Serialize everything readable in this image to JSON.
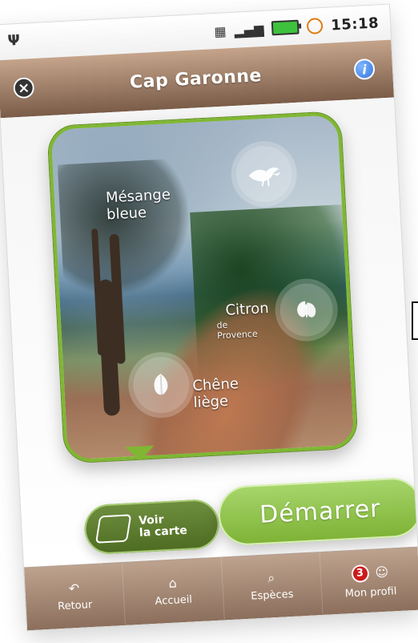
{
  "status_bar": {
    "time": "15:18",
    "icons": {
      "usb": "usb-icon",
      "signal": "signal-icon",
      "battery": "battery-icon",
      "alarm": "alarm-icon",
      "data": "data-icon"
    }
  },
  "header": {
    "title": "Cap Garonne",
    "icons": {
      "close": "close-icon",
      "info": "info-icon"
    }
  },
  "photo": {
    "pois": [
      {
        "label": "Mésange bleue",
        "icon": "bird-icon"
      },
      {
        "label": "Citron",
        "sublabel": "de Provence",
        "icon": "butterfly-icon"
      },
      {
        "label": "Chêne liège",
        "icon": "leaf-icon"
      }
    ]
  },
  "actions": {
    "map_button": {
      "line1": "Voir",
      "line2": "la carte",
      "icon": "map-icon"
    },
    "start_button": {
      "label": "Démarrer"
    }
  },
  "tabbar": {
    "tabs": [
      {
        "label": "Retour",
        "icon": "back-icon"
      },
      {
        "label": "Accueil",
        "icon": "home-icon"
      },
      {
        "label": "Espèces",
        "icon": "search-icon"
      },
      {
        "label": "Mon profil",
        "icon": "user-icon",
        "badge": "3"
      }
    ]
  },
  "colors": {
    "header_brown": "#8b6f5c",
    "accent_green": "#7fb733",
    "start_green": "#8ec44a",
    "map_green": "#5f7d2f",
    "badge_red": "#cc1a1a",
    "info_blue": "#2c6ed8"
  }
}
